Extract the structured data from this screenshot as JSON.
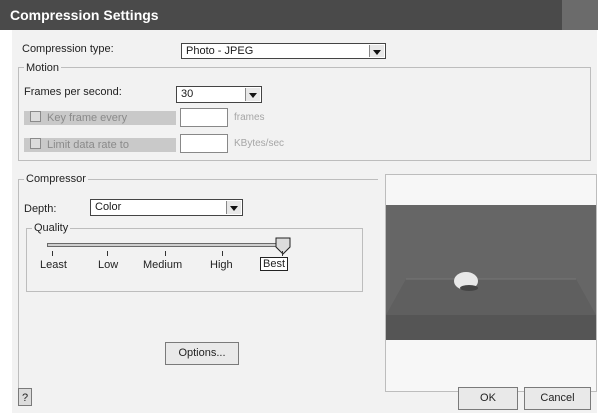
{
  "window": {
    "title": "Compression Settings"
  },
  "compression": {
    "label": "Compression type:",
    "value": "Photo - JPEG"
  },
  "motion": {
    "group_label": "Motion",
    "fps_label": "Frames per second:",
    "fps_value": "30",
    "keyframe_label": "Key frame every",
    "keyframe_unit": "frames",
    "limit_label": "Limit data rate to",
    "limit_unit": "KBytes/sec"
  },
  "compressor": {
    "group_label": "Compressor",
    "depth_label": "Depth:",
    "depth_value": "Color",
    "quality": {
      "group_label": "Quality",
      "levels": [
        "Least",
        "Low",
        "Medium",
        "High",
        "Best"
      ],
      "selected": "Best",
      "value_fraction": 1.0
    },
    "options_label": "Options..."
  },
  "buttons": {
    "help": "?",
    "ok": "OK",
    "cancel": "Cancel"
  },
  "icons": {
    "dropdown": "chevron-down-icon",
    "slider": "slider-thumb-icon"
  }
}
